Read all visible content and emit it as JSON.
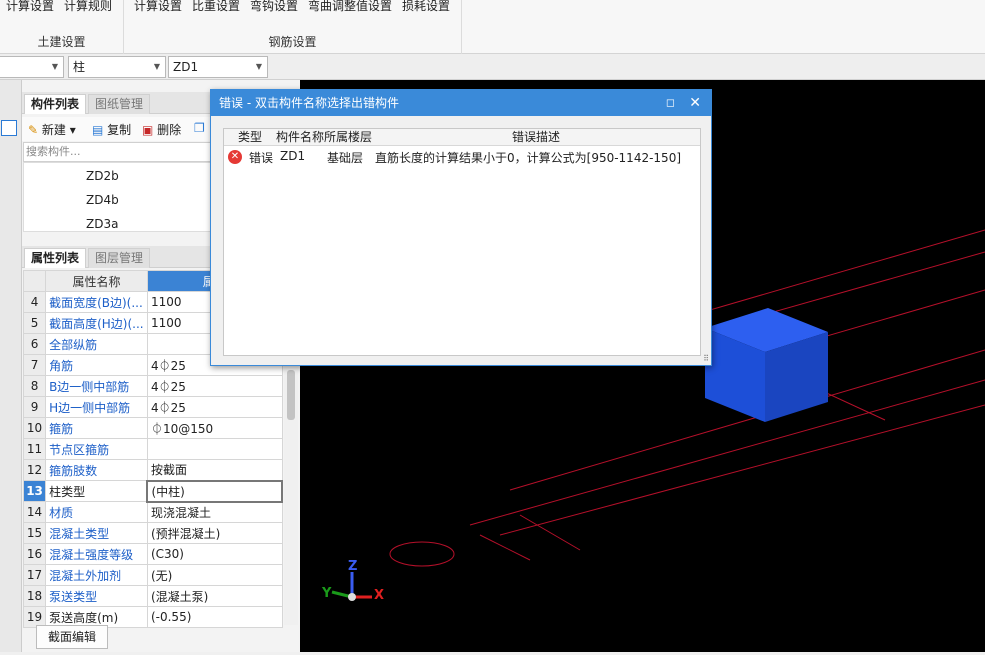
{
  "ribbon": {
    "civil_group": {
      "buttons": [
        "计算设置",
        "计算规则"
      ],
      "label": "土建设置"
    },
    "rebar_group": {
      "buttons": [
        "计算设置",
        "比重设置",
        "弯钩设置",
        "弯曲调整值设置",
        "损耗设置"
      ],
      "label": "钢筋设置"
    }
  },
  "selectors": {
    "type": "柱",
    "component": "ZD1"
  },
  "component_panel": {
    "tabs": [
      "构件列表",
      "图纸管理"
    ],
    "toolbar": {
      "new": "新建",
      "copy": "复制",
      "delete": "删除"
    },
    "search_placeholder": "搜索构件...",
    "items": [
      "ZD2b",
      "ZD4b",
      "ZD3a"
    ]
  },
  "property_panel": {
    "tabs": [
      "属性列表",
      "图层管理"
    ],
    "header": {
      "name": "属性名称",
      "value": "属性"
    },
    "rows": [
      {
        "num": "4",
        "name": "截面宽度(B边)(...",
        "value": "1100"
      },
      {
        "num": "5",
        "name": "截面高度(H边)(...",
        "value": "1100"
      },
      {
        "num": "6",
        "name": "全部纵筋",
        "value": ""
      },
      {
        "num": "7",
        "name": "角筋",
        "value": "4⏀25"
      },
      {
        "num": "8",
        "name": "B边一侧中部筋",
        "value": "4⏀25"
      },
      {
        "num": "9",
        "name": "H边一侧中部筋",
        "value": "4⏀25"
      },
      {
        "num": "10",
        "name": "箍筋",
        "value": "⏀10@150"
      },
      {
        "num": "11",
        "name": "节点区箍筋",
        "value": ""
      },
      {
        "num": "12",
        "name": "箍筋肢数",
        "value": "按截面"
      },
      {
        "num": "13",
        "name": "柱类型",
        "value": "(中柱)"
      },
      {
        "num": "14",
        "name": "材质",
        "value": "现浇混凝土"
      },
      {
        "num": "15",
        "name": "混凝土类型",
        "value": "(预拌混凝土)"
      },
      {
        "num": "16",
        "name": "混凝土强度等级",
        "value": "(C30)"
      },
      {
        "num": "17",
        "name": "混凝土外加剂",
        "value": "(无)"
      },
      {
        "num": "18",
        "name": "泵送类型",
        "value": "(混凝土泵)"
      },
      {
        "num": "19",
        "name": "泵送高度(m)",
        "value": "(-0.55)"
      }
    ],
    "edit_button": "截面编辑"
  },
  "error_dialog": {
    "title": "错误 - 双击构件名称选择出错构件",
    "columns": [
      "类型",
      "构件名称",
      "所属楼层",
      "错误描述"
    ],
    "rows": [
      {
        "type": "错误",
        "component": "ZD1",
        "floor": "基础层",
        "description": "直筋长度的计算结果小于0，计算公式为[950-1142-150]"
      }
    ]
  },
  "viewport": {
    "axes": [
      "Z",
      "Y",
      "X"
    ]
  },
  "colors": {
    "accent": "#3a8ad9",
    "error": "#e53935",
    "cube": "#1e4fd8",
    "grid": "#c8102e"
  }
}
